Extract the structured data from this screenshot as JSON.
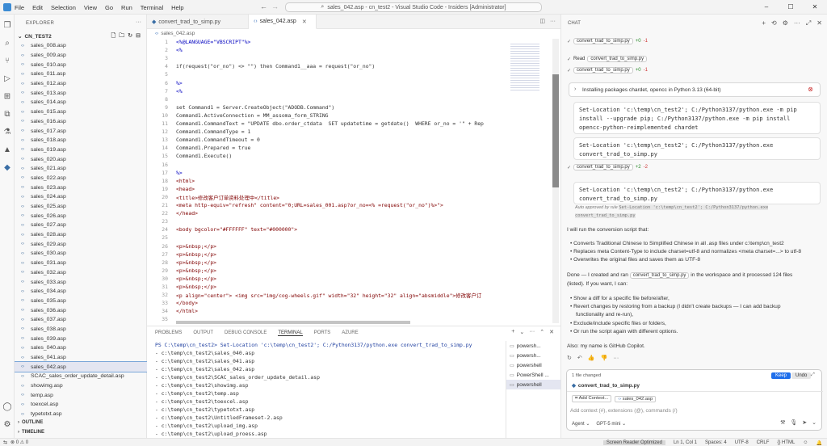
{
  "titlebar": {
    "menu": [
      "File",
      "Edit",
      "Selection",
      "View",
      "Go",
      "Run",
      "Terminal",
      "Help"
    ],
    "command_center": "sales_042.asp - cn_test2 - Visual Studio Code - Insiders [Administrator]",
    "controls": [
      "–",
      "☐",
      "✕"
    ]
  },
  "activity_icons": [
    "explorer-icon",
    "search-icon",
    "source-control-icon",
    "run-debug-icon",
    "extensions-icon",
    "remote-icon",
    "testing-icon",
    "azure-icon",
    "python-icon",
    "accounts-icon",
    "settings-icon"
  ],
  "sidebar": {
    "header": "EXPLORER",
    "folder": "CN_TEST2",
    "files": [
      "sales_008.asp",
      "sales_009.asp",
      "sales_010.asp",
      "sales_011.asp",
      "sales_012.asp",
      "sales_013.asp",
      "sales_014.asp",
      "sales_015.asp",
      "sales_016.asp",
      "sales_017.asp",
      "sales_018.asp",
      "sales_019.asp",
      "sales_020.asp",
      "sales_021.asp",
      "sales_022.asp",
      "sales_023.asp",
      "sales_024.asp",
      "sales_025.asp",
      "sales_026.asp",
      "sales_027.asp",
      "sales_028.asp",
      "sales_029.asp",
      "sales_030.asp",
      "sales_031.asp",
      "sales_032.asp",
      "sales_033.asp",
      "sales_034.asp",
      "sales_035.asp",
      "sales_036.asp",
      "sales_037.asp",
      "sales_038.asp",
      "sales_039.asp",
      "sales_040.asp",
      "sales_041.asp",
      "sales_042.asp",
      "SCAC_sales_order_update_detail.asp",
      "showimg.asp",
      "temp.asp",
      "toexcel.asp",
      "typetotxt.asp"
    ],
    "selected_index": 34,
    "outline": "OUTLINE",
    "timeline": "TIMELINE"
  },
  "tabs": [
    {
      "label": "convert_trad_to_simp.py",
      "active": false
    },
    {
      "label": "sales_042.asp",
      "active": true
    }
  ],
  "breadcrumb": "sales_042.asp",
  "code": [
    {
      "n": "1",
      "t": "<%@LANGUAGE=\"VBSCRIPT\"%>"
    },
    {
      "n": "2",
      "t": "<%"
    },
    {
      "n": "3",
      "t": ""
    },
    {
      "n": "4",
      "t": "if(request(\"or_no\") <> \"\") then Command1__aaa = request(\"or_no\")"
    },
    {
      "n": "5",
      "t": ""
    },
    {
      "n": "6",
      "t": "%>"
    },
    {
      "n": "7",
      "t": "<%"
    },
    {
      "n": "8",
      "t": ""
    },
    {
      "n": "9",
      "t": "set Command1 = Server.CreateObject(\"ADODB.Command\")"
    },
    {
      "n": "10",
      "t": "Command1.ActiveConnection = MM_assoma_form_STRING"
    },
    {
      "n": "11",
      "t": "Command1.CommandText = \"UPDATE dbo.order_ctdata  SET updatetime = getdate()  WHERE or_no = '\" + Rep"
    },
    {
      "n": "12",
      "t": "Command1.CommandType = 1"
    },
    {
      "n": "13",
      "t": "Command1.CommandTimeout = 0"
    },
    {
      "n": "14",
      "t": "Command1.Prepared = true"
    },
    {
      "n": "15",
      "t": "Command1.Execute()"
    },
    {
      "n": "16",
      "t": ""
    },
    {
      "n": "17",
      "t": "%>"
    },
    {
      "n": "18",
      "t": "<html>"
    },
    {
      "n": "19",
      "t": "<head>"
    },
    {
      "n": "20",
      "t": "<title>修改客户订单资料处理中</title>"
    },
    {
      "n": "21",
      "t": "<meta http-equiv=\"refresh\" content=\"0;URL=sales_001.asp?or_no=<% =request(\"or_no\")%>\">"
    },
    {
      "n": "22",
      "t": "</head>"
    },
    {
      "n": "23",
      "t": ""
    },
    {
      "n": "24",
      "t": "<body bgcolor=\"#FFFFFF\" text=\"#000000\">"
    },
    {
      "n": "25",
      "t": ""
    },
    {
      "n": "26",
      "t": "<p>&nbsp;</p>"
    },
    {
      "n": "27",
      "t": "<p>&nbsp;</p>"
    },
    {
      "n": "28",
      "t": "<p>&nbsp;</p>"
    },
    {
      "n": "29",
      "t": "<p>&nbsp;</p>"
    },
    {
      "n": "30",
      "t": "<p>&nbsp;</p>"
    },
    {
      "n": "31",
      "t": "<p>&nbsp;</p>"
    },
    {
      "n": "32",
      "t": "<p align=\"center\"> <img src=\"img/cog-wheels.gif\" width=\"32\" height=\"32\" align=\"absmiddle\">修改客户订"
    },
    {
      "n": "33",
      "t": "</body>"
    },
    {
      "n": "34",
      "t": "</html>"
    },
    {
      "n": "35",
      "t": ""
    }
  ],
  "panel": {
    "tabs": [
      "PROBLEMS",
      "OUTPUT",
      "DEBUG CONSOLE",
      "TERMINAL",
      "PORTS",
      "AZURE"
    ],
    "active_tab": "TERMINAL",
    "terminal": [
      "PS C:\\temp\\cn_test2> Set-Location 'c:\\temp\\cn_test2'; C:/Python3137/python.exe convert_trad_to_simp.py",
      "- c:\\temp\\cn_test2\\sales_040.asp",
      "- c:\\temp\\cn_test2\\sales_041.asp",
      "- c:\\temp\\cn_test2\\sales_042.asp",
      "- c:\\temp\\cn_test2\\SCAC_sales_order_update_detail.asp",
      "- c:\\temp\\cn_test2\\showimg.asp",
      "- c:\\temp\\cn_test2\\temp.asp",
      "- c:\\temp\\cn_test2\\toexcel.asp",
      "- c:\\temp\\cn_test2\\typetotxt.asp",
      "- c:\\temp\\cn_test2\\UntitledFrameset-2.asp",
      "- c:\\temp\\cn_test2\\upload_img.asp",
      "- c:\\temp\\cn_test2\\upload_proess.asp",
      "PS C:\\temp\\cn_test2>"
    ],
    "terminals": [
      "powersh...",
      "powersh...",
      "powershell",
      "PowerShell ...",
      "powershell"
    ],
    "terminal_active": 4
  },
  "chat": {
    "header": "CHAT",
    "edit1": {
      "file": "convert_trad_to_simp.py",
      "add": "+0",
      "del": "-1"
    },
    "read": {
      "label": "Read",
      "file": "convert_trad_to_simp.py"
    },
    "edit2": {
      "file": "convert_trad_to_simp.py",
      "add": "+0",
      "del": "-1"
    },
    "install": "Installing packages chardet, opencc in Python 3.13 (64-bit)",
    "cmd1": [
      "Set-Location 'c:\\temp\\cn_test2'; C:/Python3137/python.exe -m pip",
      "install --upgrade pip; C:/Python3137/python.exe -m pip install",
      "opencc-python-reimplemented chardet"
    ],
    "cmd2": [
      "Set-Location 'c:\\temp\\cn_test2'; C:/Python3137/python.exe",
      "convert_trad_to_simp.py"
    ],
    "edit3": {
      "file": "convert_trad_to_simp.py",
      "add": "+2",
      "del": "-2"
    },
    "cmd3": [
      "Set-Location 'c:\\temp\\cn_test2'; C:/Python3137/python.exe",
      "convert_trad_to_simp.py"
    ],
    "auto_approved_a": "Auto approved by rule",
    "auto_approved_rule": "Set-Location 'c:\\temp\\cn_test2'; C:/Python3137/python.exe",
    "auto_approved_rule2": "convert_trad_to_simp.py",
    "intro": "I will run the conversion script that:",
    "bullets1": [
      "Converts Traditional Chinese to Simplified Chinese in all .asp files under c:\\temp\\cn_test2",
      "Replaces meta Content-Type to include charset=utf-8 and normalizes <meta charset=...> to utf-8",
      "Overwrites the original files and saves them as UTF-8"
    ],
    "done_a": "Done — I created and ran",
    "done_file": "convert_trad_to_simp.py",
    "done_b": "in the workspace and it processed 124 files",
    "done_c": "(listed). If you want, I can:",
    "bullets2": [
      "Show a diff for a specific file before/after,",
      "Revert changes by restoring from a backup (I didn't create backups — I can add backup",
      "functionality and re-run),",
      "Exclude/include specific files or folders,",
      "Or run the script again with different options."
    ],
    "also": "Also: my name is GitHub Copilot.",
    "changed": "1 file changed",
    "keep": "Keep",
    "undo": "Undo",
    "changed_file": "convert_trad_to_simp.py",
    "add_context": "Add Context...",
    "context_file": "sales_042.asp",
    "placeholder": "Add context (#), extensions (@), commands (/)",
    "mode": "Agent",
    "model": "GPT-5 mini"
  },
  "status": {
    "left": "⊗ 0 ⚠ 0",
    "items": [
      "Screen Reader Optimized",
      "Ln 1, Col 1",
      "Spaces: 4",
      "UTF-8",
      "CRLF",
      "{} HTML"
    ]
  }
}
